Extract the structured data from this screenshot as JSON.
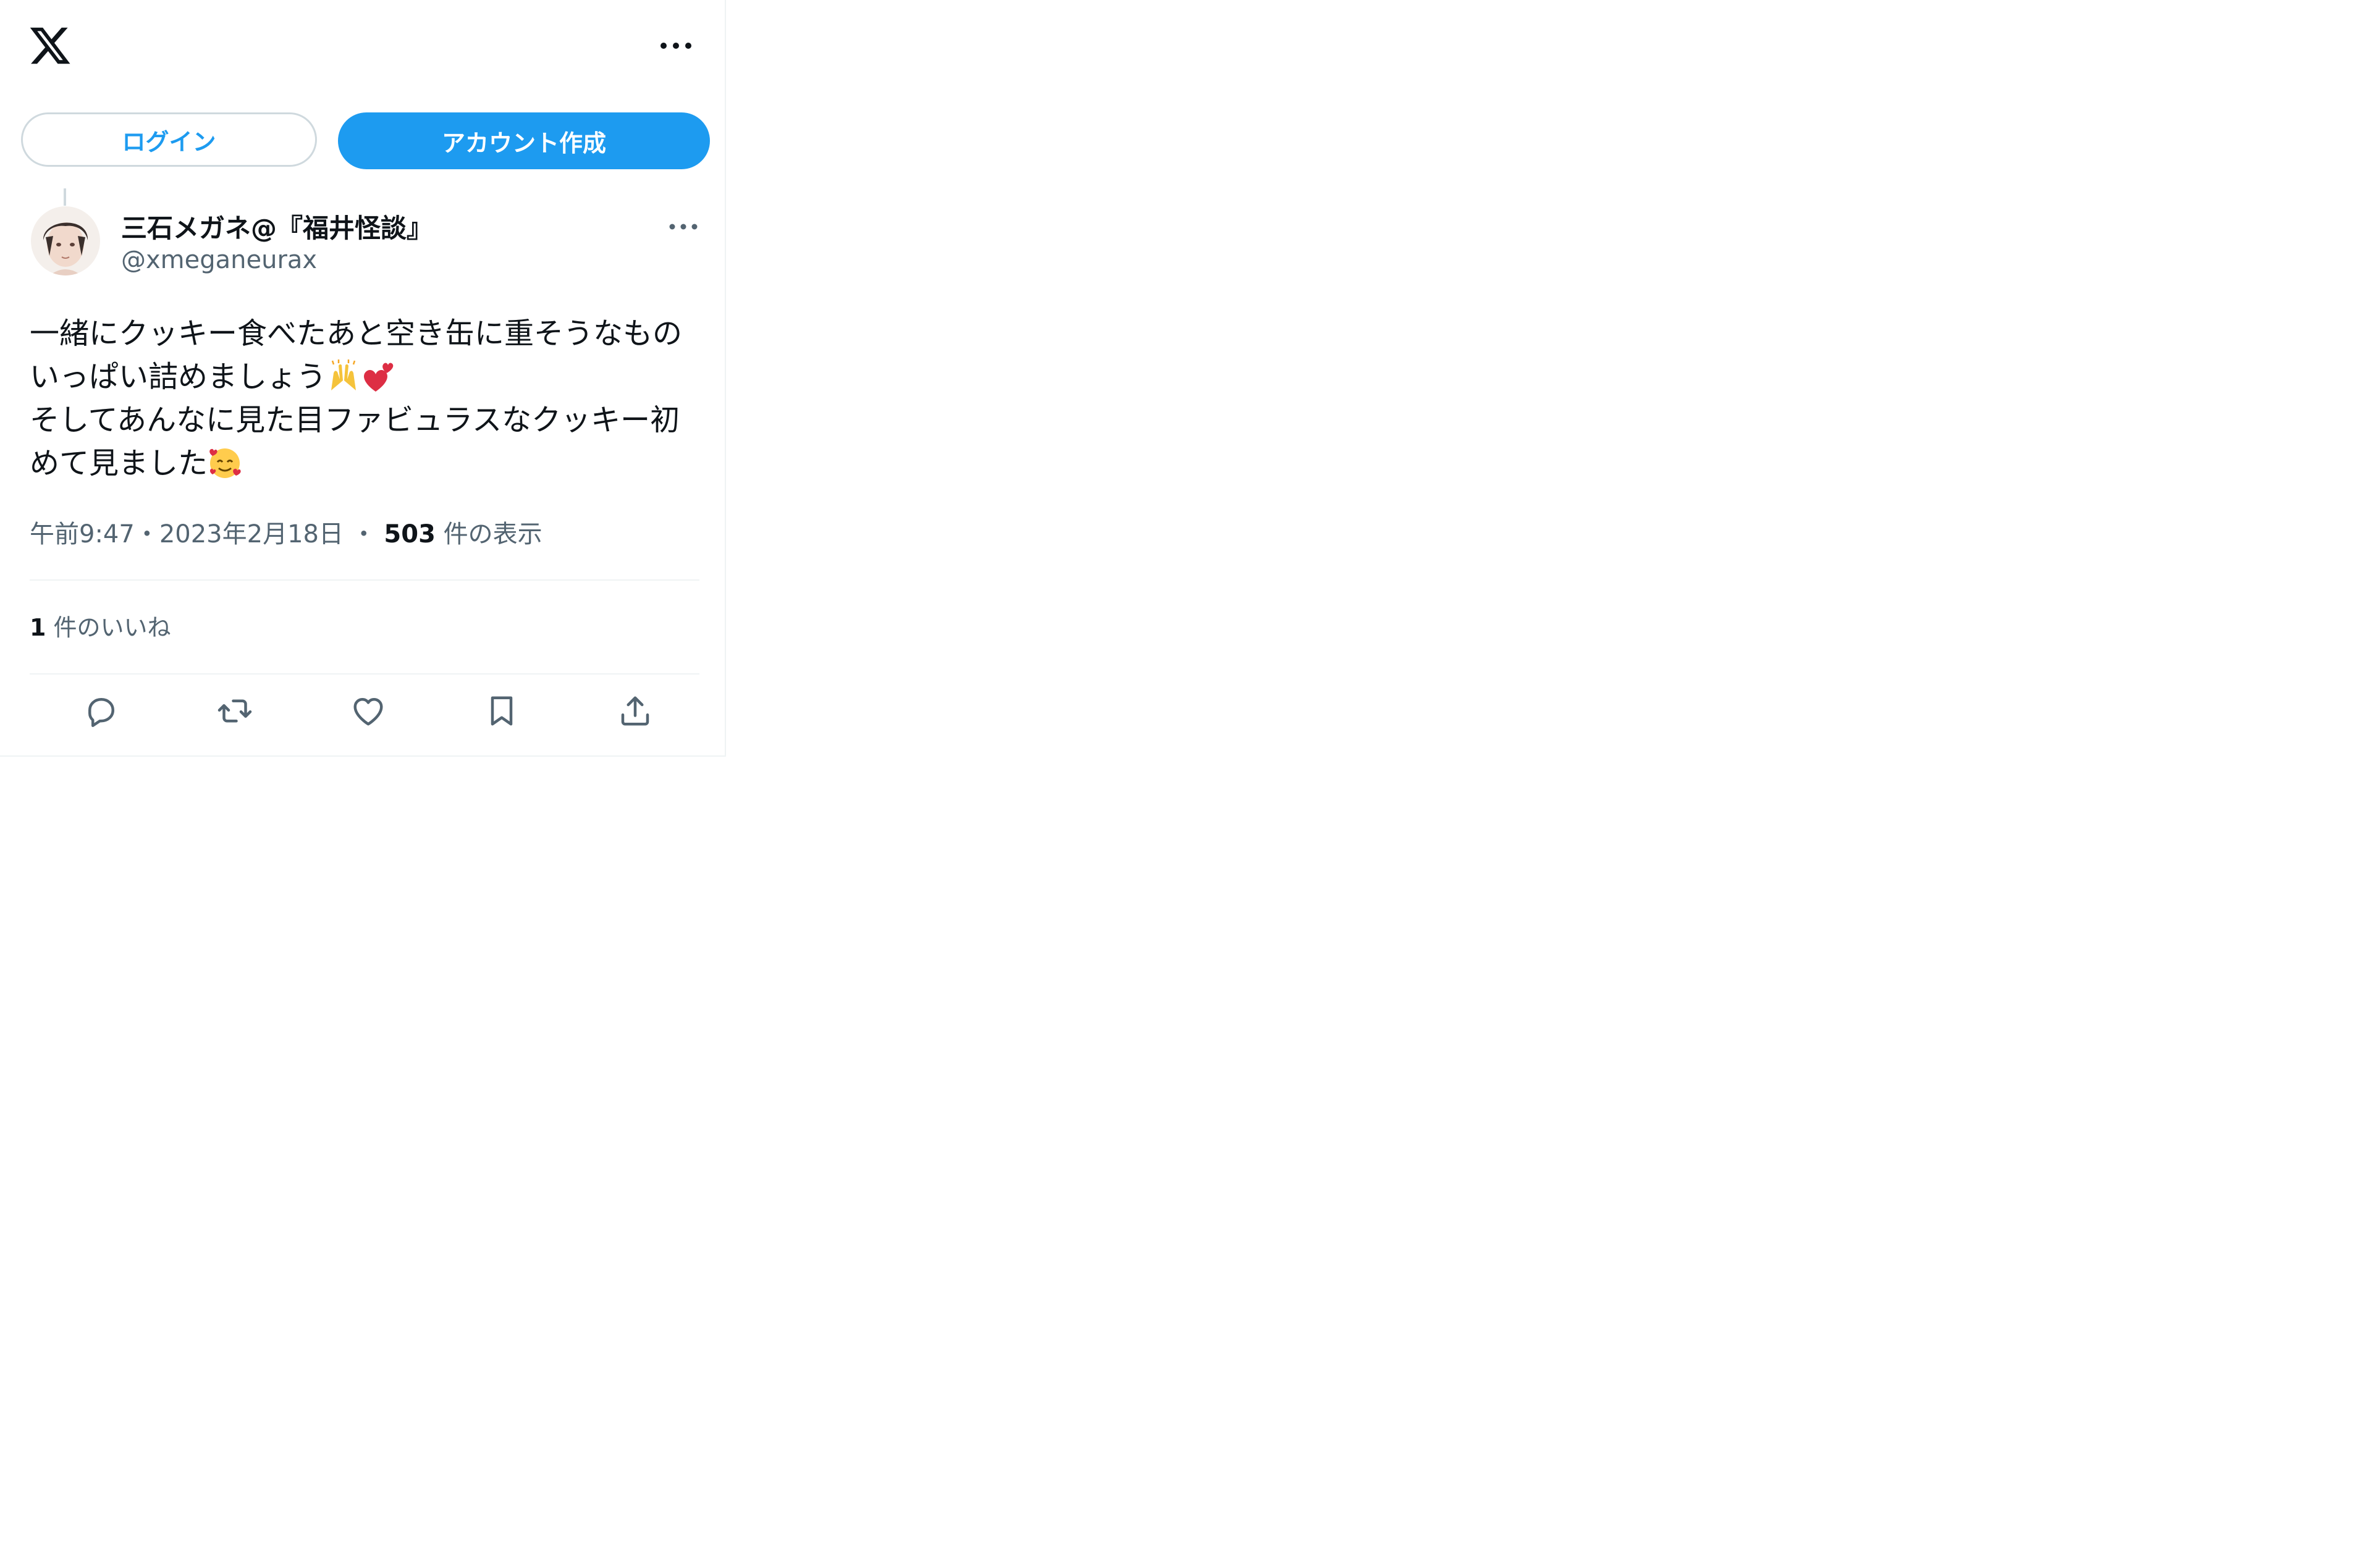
{
  "header": {
    "logo_icon": "x-logo-icon",
    "more_icon": "more-horizontal-icon"
  },
  "auth": {
    "login_label": "ログイン",
    "signup_label": "アカウント作成"
  },
  "tweet": {
    "author_name": "三石メガネ@『福井怪談』",
    "author_handle": "@xmeganeurax",
    "text_line1": "一緒にクッキー食べたあと空き缶に重そうなもの",
    "text_line2": "いっぱい詰めましょう",
    "text_line3": "そしてあんなに見た目ファビュラスなクッキー初",
    "text_line4": "めて見ました",
    "emojis": [
      "raising-hands-emoji",
      "two-hearts-emoji",
      "smiling-face-with-hearts-emoji"
    ],
    "time": "午前9:47",
    "date": "2023年2月18日",
    "separator": "・",
    "views_count": "503",
    "views_label": "件の表示",
    "likes_count": "1",
    "likes_label": "件のいいね"
  },
  "actions": [
    "reply-icon",
    "retweet-icon",
    "like-icon",
    "bookmark-icon",
    "share-icon"
  ],
  "colors": {
    "accent": "#1d9bf0",
    "text_primary": "#0f1419",
    "text_secondary": "#536471",
    "border": "#cfd9de",
    "divider": "#eff3f4"
  }
}
